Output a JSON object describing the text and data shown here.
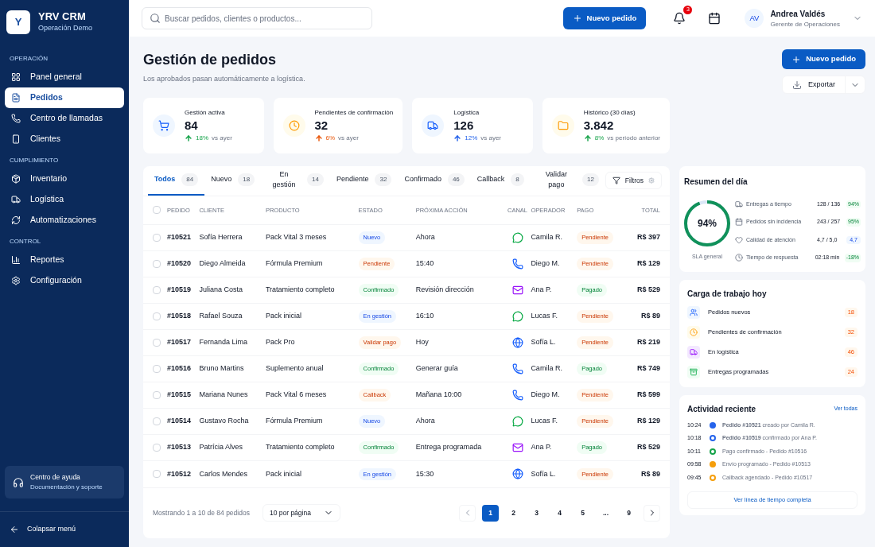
{
  "brand": {
    "logo": "Y",
    "name": "YRV CRM",
    "subtitle": "Operación Demo"
  },
  "sidebar": {
    "sections": [
      {
        "title": "OPERACIÓN",
        "items": [
          {
            "label": "Panel general",
            "selected": false
          },
          {
            "label": "Pedidos",
            "selected": true
          },
          {
            "label": "Centro de llamadas",
            "selected": false
          },
          {
            "label": "Clientes",
            "selected": false
          }
        ]
      },
      {
        "title": "CUMPLIMIENTO",
        "items": [
          {
            "label": "Inventario",
            "selected": false
          },
          {
            "label": "Logística",
            "selected": false
          },
          {
            "label": "Automatizaciones",
            "selected": false
          }
        ]
      },
      {
        "title": "CONTROL",
        "items": [
          {
            "label": "Reportes",
            "selected": false
          },
          {
            "label": "Configuración",
            "selected": false
          }
        ]
      }
    ],
    "help": {
      "title": "Centro de ayuda",
      "subtitle": "Documentación y soporte"
    },
    "collapse": "Colapsar menú"
  },
  "topbar": {
    "search": {
      "placeholder": "Buscar pedidos, clientes o productos..."
    },
    "new_button": "Nuevo pedido",
    "notifications": "3",
    "user": {
      "initials": "AV",
      "name": "Andrea Valdés",
      "role": "Gerente de Operaciones"
    }
  },
  "page": {
    "title": "Gestión de pedidos",
    "subtitle": "Los aprobados pasan automáticamente a logística.",
    "primary_button": "Nuevo pedido",
    "export_button": "Exportar"
  },
  "stats": [
    {
      "kind": "cart",
      "label": "Gestión activa",
      "value": "84",
      "change": "18%",
      "rest": "vs ayer",
      "color": "#16a34a"
    },
    {
      "kind": "clock",
      "label": "Pendientes de confirmación",
      "value": "32",
      "change": "6%",
      "rest": "vs ayer",
      "color": "#ea580c"
    },
    {
      "kind": "truck",
      "label": "Logística",
      "value": "126",
      "change": "12%",
      "rest": "vs ayer",
      "color": "#2563eb"
    },
    {
      "kind": "folder",
      "label": "Histórico (30 días)",
      "value": "3.842",
      "change": "8%",
      "rest": "vs período anterior",
      "color": "#16a34a"
    }
  ],
  "tabs": [
    {
      "label": "Todos",
      "count": "84",
      "selected": true
    },
    {
      "label": "Nuevo",
      "count": "18",
      "selected": false
    },
    {
      "label": "En gestión",
      "count": "14",
      "selected": false
    },
    {
      "label": "Pendiente",
      "count": "32",
      "selected": false
    },
    {
      "label": "Confirmado",
      "count": "46",
      "selected": false
    },
    {
      "label": "Callback",
      "count": "8",
      "selected": false
    },
    {
      "label": "Validar pago",
      "count": "12",
      "selected": false
    }
  ],
  "filter_button": "Filtros",
  "table": {
    "select_all": false,
    "columns": [
      "PEDIDO",
      "CLIENTE",
      "PRODUCTO",
      "ESTADO",
      "PRÓXIMA ACCIÓN",
      "CANAL",
      "OPERADOR",
      "PAGO",
      "TOTAL"
    ],
    "rows": [
      {
        "checked": false,
        "order": "#10521",
        "client": "Sofía Herrera",
        "product": "Pack Vital 3 meses",
        "status": {
          "label": "Nuevo",
          "kind": "blue"
        },
        "next": "Ahora",
        "channel": {
          "kind": "whatsapp"
        },
        "operator": "Camila R.",
        "payment": {
          "label": "Pendiente",
          "kind": "orange"
        },
        "total": "R$ 397"
      },
      {
        "checked": false,
        "order": "#10520",
        "client": "Diego Almeida",
        "product": "Fórmula Premium",
        "status": {
          "label": "Pendiente",
          "kind": "orange"
        },
        "next": "15:40",
        "channel": {
          "kind": "phone"
        },
        "operator": "Diego M.",
        "payment": {
          "label": "Pendiente",
          "kind": "orange"
        },
        "total": "R$ 129"
      },
      {
        "checked": false,
        "order": "#10519",
        "client": "Juliana Costa",
        "product": "Tratamiento completo",
        "status": {
          "label": "Confirmado",
          "kind": "green"
        },
        "next": "Revisión dirección",
        "channel": {
          "kind": "email"
        },
        "operator": "Ana P.",
        "payment": {
          "label": "Pagado",
          "kind": "green"
        },
        "total": "R$ 529"
      },
      {
        "checked": false,
        "order": "#10518",
        "client": "Rafael Souza",
        "product": "Pack inicial",
        "status": {
          "label": "En gestión",
          "kind": "blue"
        },
        "next": "16:10",
        "channel": {
          "kind": "whatsapp"
        },
        "operator": "Lucas F.",
        "payment": {
          "label": "Pendiente",
          "kind": "orange"
        },
        "total": "R$ 89"
      },
      {
        "checked": false,
        "order": "#10517",
        "client": "Fernanda Lima",
        "product": "Pack Pro",
        "status": {
          "label": "Validar pago",
          "kind": "orange"
        },
        "next": "Hoy",
        "channel": {
          "kind": "web"
        },
        "operator": "Sofía L.",
        "payment": {
          "label": "Pendiente",
          "kind": "orange"
        },
        "total": "R$ 219"
      },
      {
        "checked": false,
        "order": "#10516",
        "client": "Bruno Martins",
        "product": "Suplemento anual",
        "status": {
          "label": "Confirmado",
          "kind": "green"
        },
        "next": "Generar guía",
        "channel": {
          "kind": "phone"
        },
        "operator": "Camila R.",
        "payment": {
          "label": "Pagado",
          "kind": "green"
        },
        "total": "R$ 749"
      },
      {
        "checked": false,
        "order": "#10515",
        "client": "Mariana Nunes",
        "product": "Pack Vital 6 meses",
        "status": {
          "label": "Callback",
          "kind": "orange"
        },
        "next": "Mañana 10:00",
        "channel": {
          "kind": "phone"
        },
        "operator": "Diego M.",
        "payment": {
          "label": "Pendiente",
          "kind": "orange"
        },
        "total": "R$ 599"
      },
      {
        "checked": false,
        "order": "#10514",
        "client": "Gustavo Rocha",
        "product": "Fórmula Premium",
        "status": {
          "label": "Nuevo",
          "kind": "blue"
        },
        "next": "Ahora",
        "channel": {
          "kind": "whatsapp"
        },
        "operator": "Lucas F.",
        "payment": {
          "label": "Pendiente",
          "kind": "orange"
        },
        "total": "R$ 129"
      },
      {
        "checked": false,
        "order": "#10513",
        "client": "Patrícia Alves",
        "product": "Tratamiento completo",
        "status": {
          "label": "Confirmado",
          "kind": "green"
        },
        "next": "Entrega programada",
        "channel": {
          "kind": "email"
        },
        "operator": "Ana P.",
        "payment": {
          "label": "Pagado",
          "kind": "green"
        },
        "total": "R$ 529"
      },
      {
        "checked": false,
        "order": "#10512",
        "client": "Carlos Mendes",
        "product": "Pack inicial",
        "status": {
          "label": "En gestión",
          "kind": "blue"
        },
        "next": "15:30",
        "channel": {
          "kind": "web"
        },
        "operator": "Sofía L.",
        "payment": {
          "label": "Pendiente",
          "kind": "orange"
        },
        "total": "R$ 89"
      }
    ]
  },
  "pagination": {
    "summary": "Mostrando 1 a 10 de 84 pedidos",
    "per_page": "10 por página",
    "pages": [
      {
        "label": "1",
        "selected": true
      },
      {
        "label": "2",
        "selected": false
      },
      {
        "label": "3",
        "selected": false
      },
      {
        "label": "4",
        "selected": false
      },
      {
        "label": "5",
        "selected": false
      },
      {
        "label": "...",
        "selected": false
      },
      {
        "label": "9",
        "selected": false
      }
    ]
  },
  "summary": {
    "title": "Resumen del día",
    "level": 0.94,
    "value": "94%",
    "caption": "SLA general",
    "metrics": [
      {
        "kind": "truck",
        "label": "Entregas a tiempo",
        "value": "128 / 136",
        "badge": {
          "label": "94%",
          "kind": "green"
        }
      },
      {
        "kind": "calendar",
        "label": "Pedidos sin incidencia",
        "value": "243 / 257",
        "badge": {
          "label": "95%",
          "kind": "green"
        }
      },
      {
        "kind": "heart",
        "label": "Calidad de atención",
        "value": "4,7 / 5,0",
        "badge": {
          "label": "4,7",
          "kind": "blue"
        }
      },
      {
        "kind": "clock",
        "label": "Tiempo de respuesta",
        "value": "02:18 min",
        "badge": {
          "label": "-18%",
          "kind": "green"
        }
      }
    ]
  },
  "workload": {
    "title": "Carga de trabajo hoy",
    "items": [
      {
        "kind": "users",
        "label": "Pedidos nuevos",
        "count": "18"
      },
      {
        "kind": "clock",
        "label": "Pendientes de confirmación",
        "count": "32"
      },
      {
        "kind": "truck",
        "label": "En logística",
        "count": "46"
      },
      {
        "kind": "box",
        "label": "Entregas programadas",
        "count": "24"
      }
    ]
  },
  "activity": {
    "title": "Actividad reciente",
    "link": "Ver todas",
    "items": [
      {
        "time": "10:24",
        "color": "#2563eb",
        "kind": "filled",
        "text": "**Pedido #10521** creado por Camila R."
      },
      {
        "time": "10:18",
        "color": "#2563eb",
        "kind": "ring",
        "text": "**Pedido #10519** confirmado por Ana P."
      },
      {
        "time": "10:11",
        "color": "#16a34a",
        "kind": "ring",
        "text": "Pago confirmado - Pedido #10516"
      },
      {
        "time": "09:58",
        "color": "#f59e0b",
        "kind": "filled",
        "text": "Envío programado - Pedido #10513"
      },
      {
        "time": "09:45",
        "color": "#f59e0b",
        "kind": "ring",
        "text": "Callback agendado - Pedido #10517"
      }
    ],
    "button": "Ver línea de tiempo completa"
  }
}
